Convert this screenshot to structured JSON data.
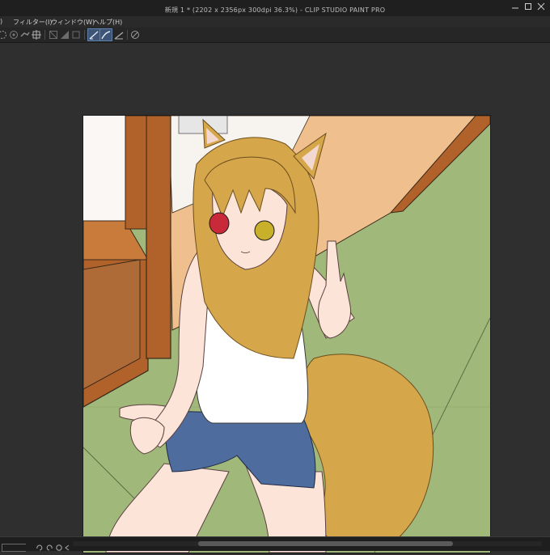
{
  "window": {
    "title": "新規 1 * (2202 x 2356px 300dpi 36.3%) - CLIP STUDIO PAINT PRO"
  },
  "menu": {
    "items": [
      "フィルター(I)",
      "ウィンドウ(W)",
      "ヘルプ(H)"
    ]
  },
  "toolbar": {
    "icons": [
      "transform-icon",
      "snap-ruler-icon",
      "snap-special-icon",
      "snap-grid-icon",
      "fill-icon",
      "fill-selection-icon",
      "clear-icon",
      "stroke-icon",
      "correction-icon",
      "draw-icon",
      "rotate-icon"
    ]
  },
  "colors": {
    "tatami": "#a0b87a",
    "wood": "#b0622a",
    "floor": "#f0bf8e",
    "skin": "#fce4d8",
    "hair": "#d6a64a",
    "shorts": "#4f6c9f",
    "eye_left": "#c82a3a",
    "eye_right": "#c8b02a"
  }
}
